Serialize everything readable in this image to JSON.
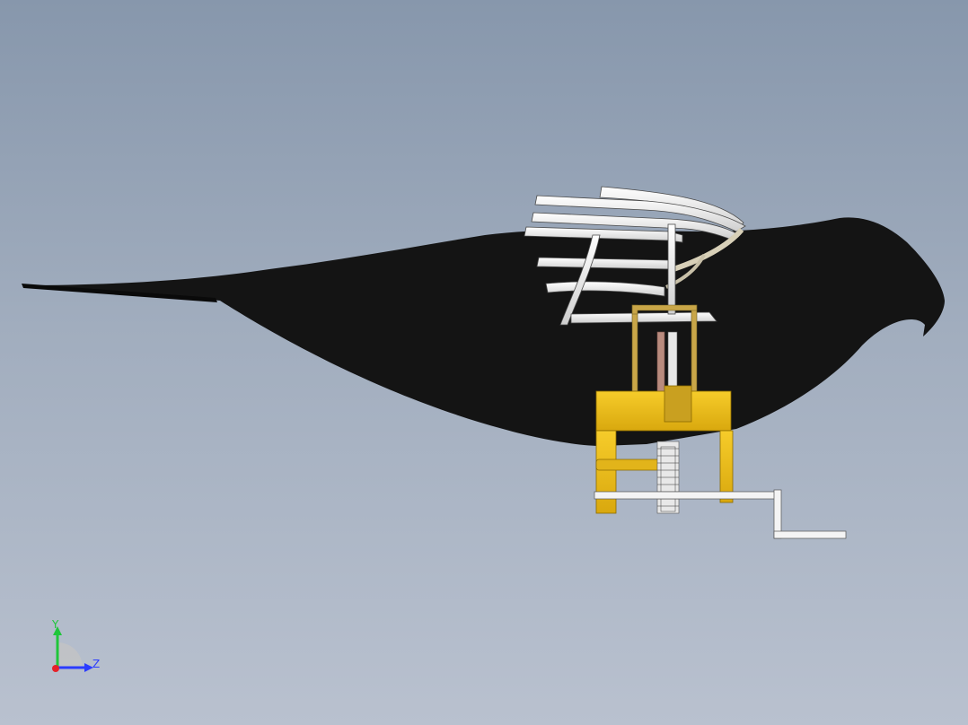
{
  "window": {
    "background_top": "#8797ac",
    "background_bottom": "#b9c1cf"
  },
  "model": {
    "body_color": "#141414",
    "frame_color": "#f0c21a",
    "wing_color": "#f4f4f4",
    "rod_color": "#b98b7e"
  },
  "triad": {
    "y_label": "Y",
    "z_label": "Z",
    "y_color": "#1fc63a",
    "z_color": "#2b3cff",
    "x_color": "#e5222a"
  }
}
